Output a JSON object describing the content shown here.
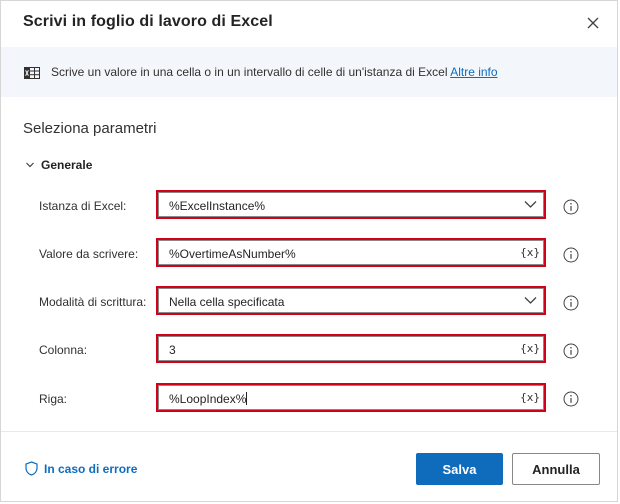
{
  "dialog": {
    "title": "Scrivi in foglio di lavoro di Excel"
  },
  "info": {
    "icon": "excel-icon",
    "text": "Scrive un valore in una cella o in un intervallo di celle di un'istanza di Excel",
    "link": "Altre info"
  },
  "section": {
    "title": "Seleziona parametri"
  },
  "group": {
    "label": "Generale"
  },
  "fields": {
    "instance": {
      "label": "Istanza di Excel:",
      "value": "%ExcelInstance%"
    },
    "value": {
      "label": "Valore da scrivere:",
      "value": "%OvertimeAsNumber%",
      "var_button": "{x}"
    },
    "mode": {
      "label": "Modalità di scrittura:",
      "value": "Nella cella specificata"
    },
    "column": {
      "label": "Colonna:",
      "value": "3",
      "var_button": "{x}"
    },
    "row": {
      "label": "Riga:",
      "value": "%LoopIndex%",
      "var_button": "{x}"
    }
  },
  "footer": {
    "error_link": "In caso di errore",
    "save": "Salva",
    "cancel": "Annulla"
  },
  "colors": {
    "accent": "#0f6cbd",
    "highlight": "#d0021b",
    "info_bar": "#f3f6fb"
  }
}
